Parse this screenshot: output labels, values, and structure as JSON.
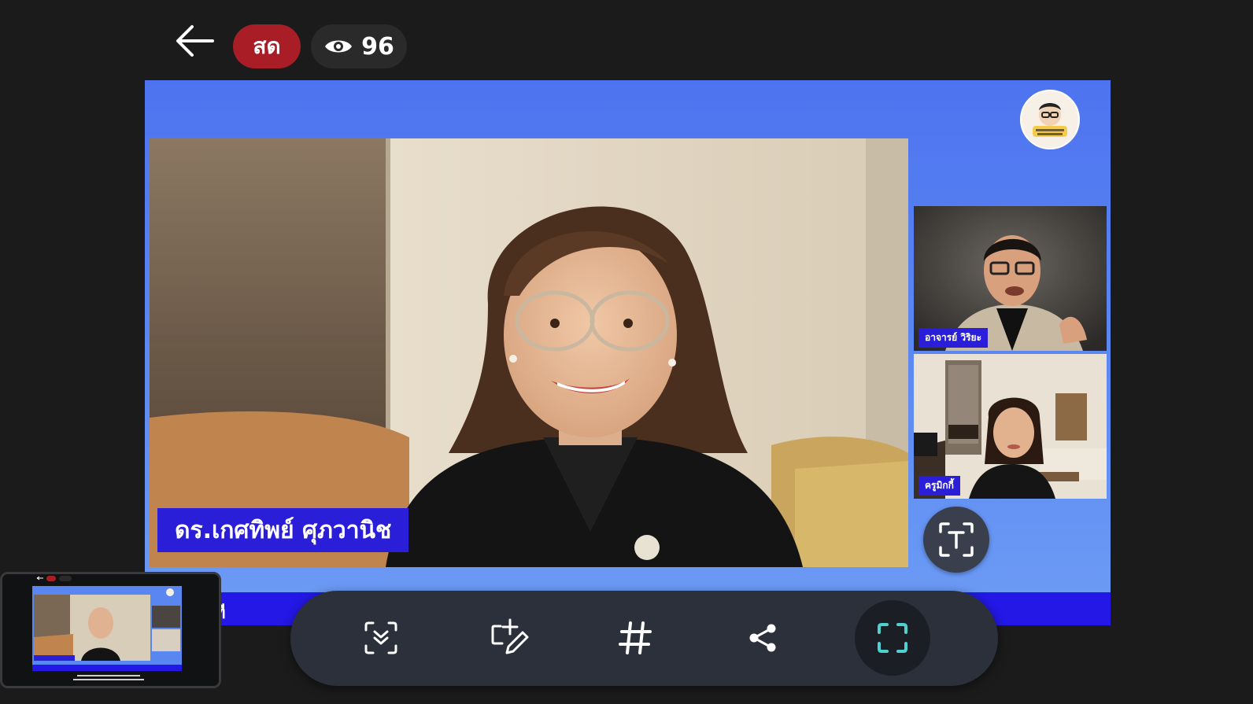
{
  "top_bar": {
    "back_icon": "arrow-left-icon",
    "live_label": "สด",
    "viewer_icon": "eye-icon",
    "viewer_count": "96"
  },
  "stream": {
    "main_speaker_name": "ดร.เกศทิพย์ ศุภวานิช",
    "side_speakers": [
      {
        "name": "อาจารย์ วิริยะ"
      },
      {
        "name": "ครูมิกกี้"
      }
    ],
    "bottom_strip_text": "ที",
    "logo_icon": "channel-logo-icon"
  },
  "text_tool": {
    "icon": "text-recognition-icon"
  },
  "toolbar": {
    "buttons": [
      {
        "icon": "scan-down-icon"
      },
      {
        "icon": "add-edit-icon"
      },
      {
        "icon": "hashtag-icon"
      },
      {
        "icon": "share-icon"
      },
      {
        "icon": "fullscreen-icon",
        "active": true
      }
    ]
  },
  "colors": {
    "live_red": "#a91e26",
    "stream_blue": "#5a86f2",
    "name_tag_blue": "#2a1ed8",
    "toolbar_bg": "#2c303a",
    "fullscreen_accent": "#4fd1d0"
  }
}
